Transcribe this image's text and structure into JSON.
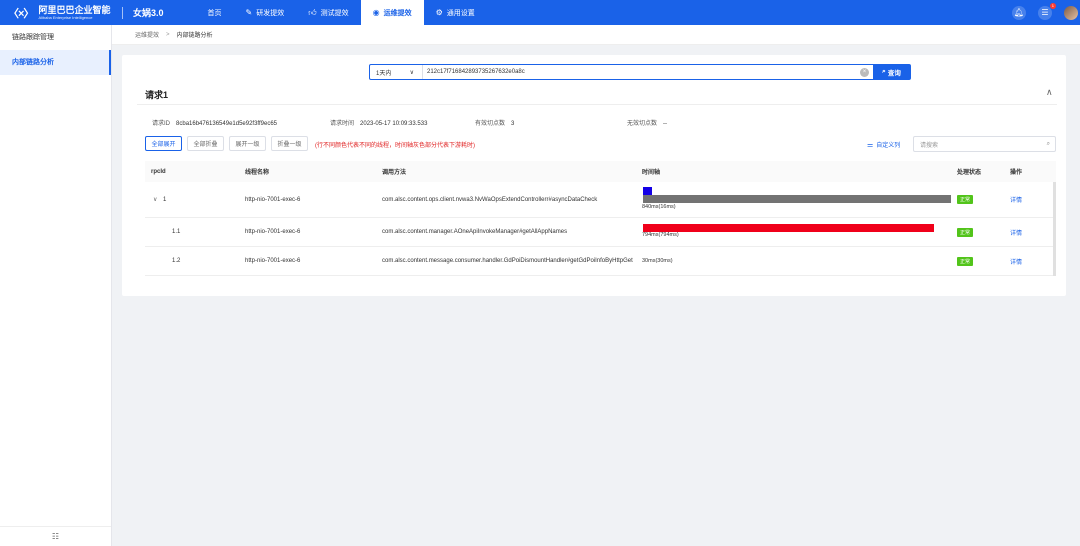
{
  "brand": {
    "logo_mark": "〈×〉",
    "name_cn": "阿里巴巴企业智能",
    "name_en": "Alibaba Enterprise Intelligence",
    "app": "女娲3.0"
  },
  "nav": [
    {
      "label": "首页",
      "icon": ""
    },
    {
      "label": "研发提效",
      "icon": "edit-icon"
    },
    {
      "label": "测试提效",
      "icon": "thumb-icon"
    },
    {
      "label": "运维提效",
      "icon": "eye-icon"
    },
    {
      "label": "通用设置",
      "icon": "gear-icon"
    }
  ],
  "nav_active": "运维提效",
  "notifications": {
    "badge": "1"
  },
  "sidebar": {
    "items": [
      {
        "label": "链路跟踪管理"
      },
      {
        "label": "内部链路分析"
      }
    ],
    "active": "内部链路分析"
  },
  "breadcrumb": {
    "parent": "运维提效",
    "sep": ">",
    "current": "内部链路分析"
  },
  "search": {
    "range": "1天内",
    "query": "212c17f7168428937352676 32e0a8c",
    "query_exact": "212c17f716842893735267632e0a8c",
    "button": "查询"
  },
  "request": {
    "title": "请求1",
    "id_label": "请求ID",
    "id_value": "8cba16b476136549e1d5e92f3ff9ec65",
    "time_label": "请求时间",
    "time_value": "2023-05-17 10:09:33.533",
    "valid_label": "有效切点数",
    "valid_value": "3",
    "invalid_label": "无效切点数",
    "invalid_value": "--"
  },
  "toolbar": {
    "expand_all": "全部展开",
    "collapse_all": "全部折叠",
    "expand_one": "展开一级",
    "collapse_one": "折叠一级",
    "tip": "(行不同颜色代表不同的线程，时间轴灰色部分代表下游耗时)",
    "custom_columns": "自定义列",
    "search_placeholder": "请搜索"
  },
  "table": {
    "columns": [
      "rpcId",
      "线程名称",
      "调用方法",
      "时间轴",
      "处理状态",
      "操作"
    ],
    "rows": [
      {
        "rpcid": "1",
        "expand": "∨",
        "thread": "http-nio-7001-exec-6",
        "method": "com.alsc.content.ops.client.nvwa3.NvWaOpsExtendControllerr#asyncDataCheck",
        "time": "840ms(16ms)",
        "status": "正常",
        "action": "详情",
        "own_ms": 16,
        "total_ms": 840,
        "own_color": "#1400e6",
        "total_color": "#737373"
      },
      {
        "rpcid": "1.1",
        "expand": "",
        "thread": "http-nio-7001-exec-6",
        "method": "com.alsc.content.manager.AOneApiInvokeManager#getAllAppNames",
        "time": "794ms(794ms)",
        "status": "正常",
        "action": "详情",
        "own_ms": 794,
        "total_ms": 794,
        "own_color": "#f0001a",
        "total_color": "#f0001a"
      },
      {
        "rpcid": "1.2",
        "expand": "",
        "thread": "http-nio-7001-exec-6",
        "method": "com.alsc.content.message.consumer.handler.GdPoiDismountHandler#getGdPoiInfoByHttpGet",
        "time": "30ms(30ms)",
        "status": "正常",
        "action": "详情",
        "own_ms": 30,
        "total_ms": 30,
        "own_color": "#f0001a",
        "total_color": "#f0001a"
      }
    ]
  }
}
